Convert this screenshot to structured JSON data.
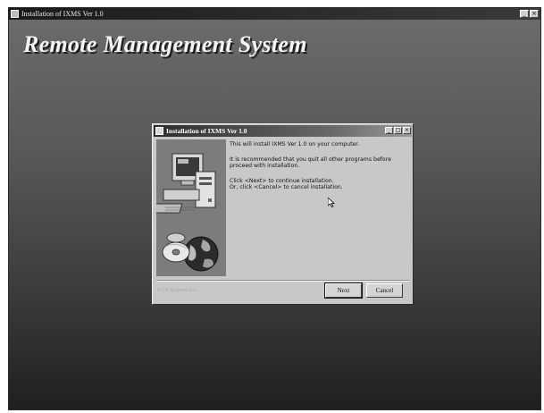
{
  "outer_window": {
    "title": "Installation of IXMS Ver 1.0",
    "headline": "Remote Management System",
    "buttons": {
      "minimize": "_",
      "close": "×"
    }
  },
  "dialog": {
    "title": "Installation of IXMS Ver 1.0",
    "buttons": {
      "minimize": "_",
      "maximize": "□",
      "close": "×"
    },
    "messages": [
      "This will install IXMS Ver 1.0 on your computer.",
      "It is recommended that you quit all other programs before proceed with installation.",
      "Click <Next> to continue installation.",
      "Or, click <Cancel> to cancel installation."
    ],
    "brand": "KT/P Systems Inc.",
    "next_label": "Next",
    "cancel_label": "Cancel"
  },
  "icons": [
    "app-icon",
    "computer-illustration-icon",
    "cd-disc-icon",
    "globe-icon",
    "mouse-cursor-icon"
  ],
  "colors": {
    "dialog_bg": "#c8c8c8",
    "titlebar": "#2c2c2c",
    "desktop_top": "#6c6c6c",
    "desktop_bottom": "#1f1f1f"
  }
}
